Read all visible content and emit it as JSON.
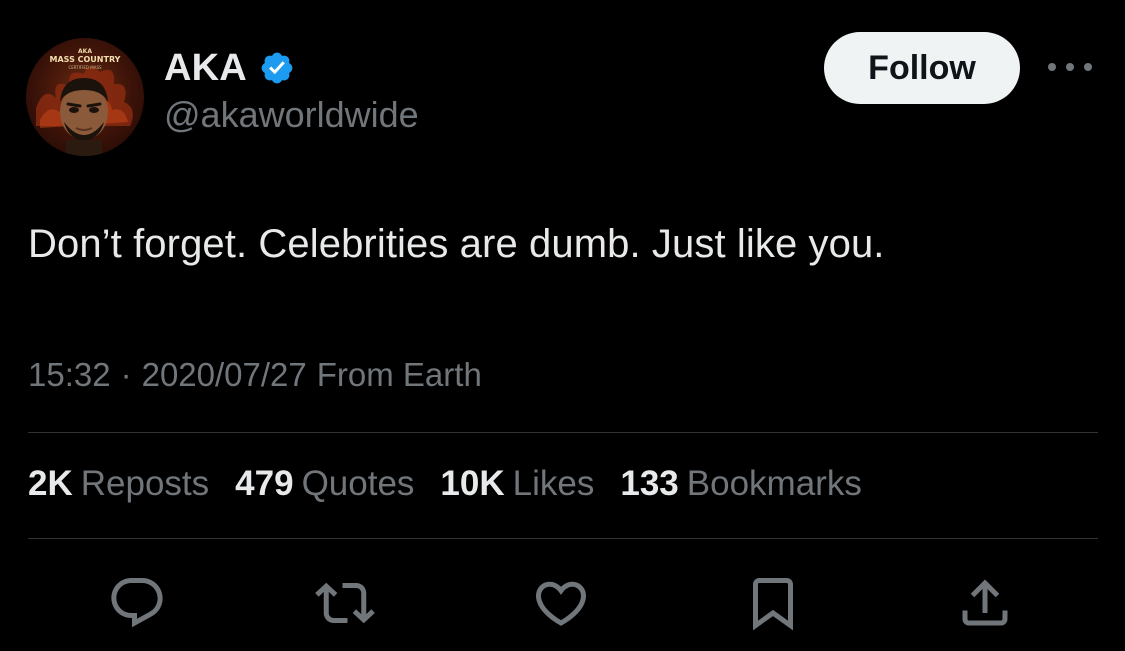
{
  "author": {
    "display_name": "AKA",
    "handle": "@akaworldwide",
    "verified": true,
    "avatar_icon": "profile-avatar",
    "avatar_text": {
      "top": "AKA",
      "title": "MASS COUNTRY",
      "subtitle": "CERTIFIED MASS"
    }
  },
  "header": {
    "follow_label": "Follow",
    "more_icon": "more-dots-icon"
  },
  "tweet": {
    "text": "Don’t forget. Celebrities are dumb. Just like you.",
    "time": "15:32",
    "separator": "·",
    "date": "2020/07/27",
    "source": "From Earth"
  },
  "stats": [
    {
      "count": "2K",
      "label": "Reposts"
    },
    {
      "count": "479",
      "label": "Quotes"
    },
    {
      "count": "10K",
      "label": "Likes"
    },
    {
      "count": "133",
      "label": "Bookmarks"
    }
  ],
  "actions": [
    {
      "icon": "reply-icon"
    },
    {
      "icon": "repost-icon"
    },
    {
      "icon": "like-icon"
    },
    {
      "icon": "bookmark-icon"
    },
    {
      "icon": "share-icon"
    }
  ],
  "colors": {
    "background": "#000000",
    "text_primary": "#e7e9ea",
    "text_secondary": "#71767b",
    "verified_blue": "#1d9bf0",
    "divider": "#2f3336",
    "follow_bg": "#eff3f4"
  }
}
